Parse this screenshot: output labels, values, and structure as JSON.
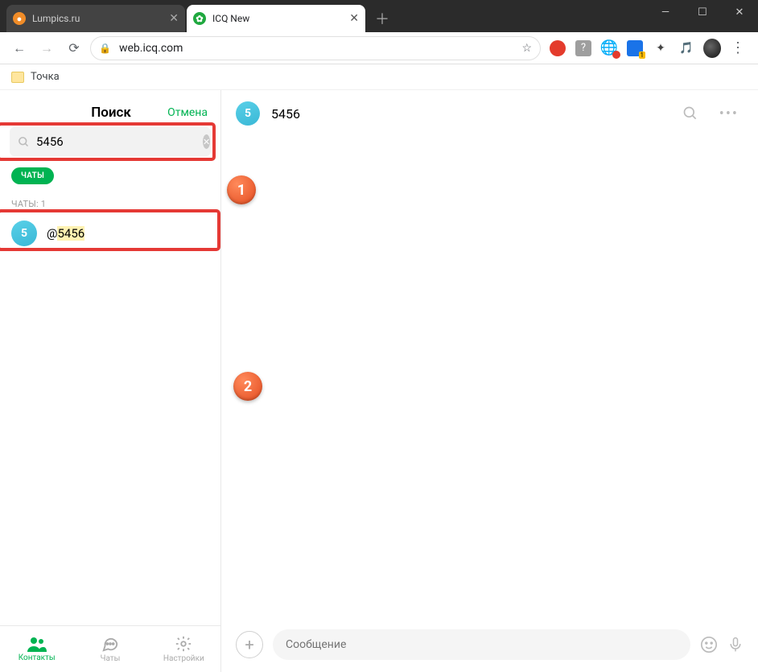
{
  "browser": {
    "tabs": [
      {
        "title": "Lumpics.ru",
        "favicon_color": "#f08c28"
      },
      {
        "title": "ICQ New",
        "favicon_color": "#1fa83f"
      }
    ],
    "url": "web.icq.com",
    "bookmark": "Точка"
  },
  "sidebar": {
    "title": "Поиск",
    "cancel": "Отмена",
    "search_value": "5456",
    "badge": "ЧАТЫ",
    "section_label": "ЧАТЫ: 1",
    "result_prefix": "@",
    "result_highlight": "5456",
    "result_avatar_letter": "5"
  },
  "nav": {
    "contacts": "Контакты",
    "chats": "Чаты",
    "settings": "Настройки"
  },
  "chat": {
    "avatar_letter": "5",
    "title": "5456",
    "composer_placeholder": "Сообщение"
  },
  "annotations": {
    "one": "1",
    "two": "2"
  }
}
